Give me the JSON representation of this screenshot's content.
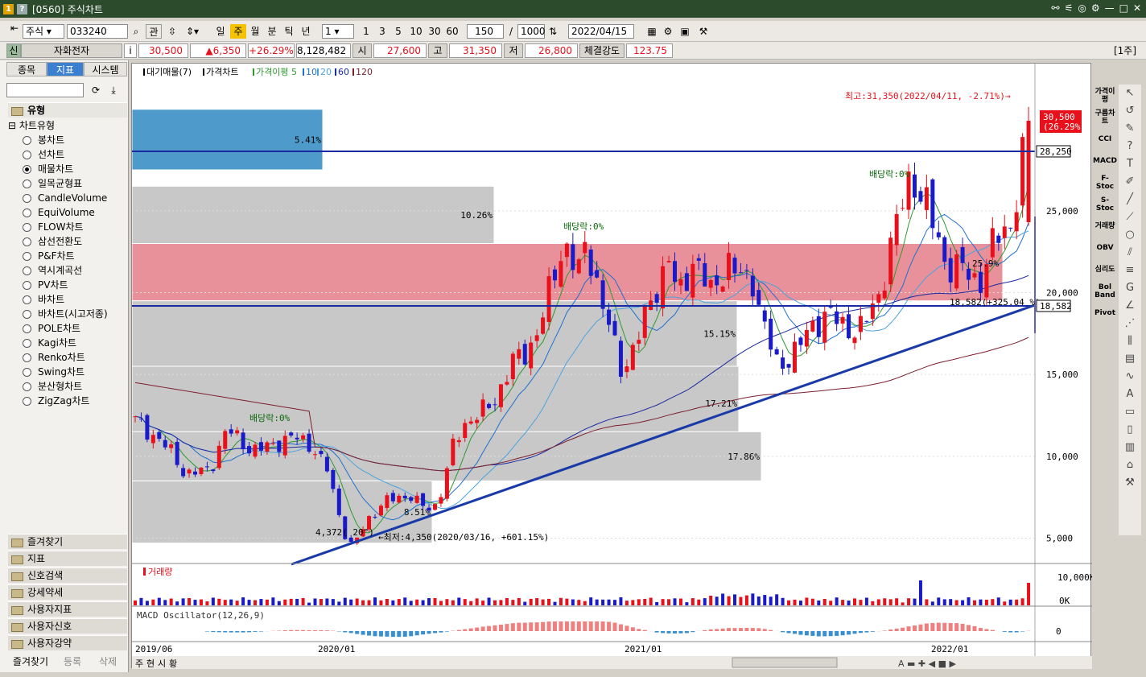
{
  "window": {
    "title": "[0560] 주식차트",
    "ico1": "1",
    "ico2": "?",
    "controls": [
      "⚯",
      "⚟",
      "◎",
      "⚙",
      "—",
      "□",
      "✕"
    ]
  },
  "toolbar": {
    "market": "주식",
    "code": "033240",
    "btn_gwan": "관",
    "periods": [
      "일",
      "주",
      "월",
      "분",
      "틱",
      "년"
    ],
    "unit": "1",
    "quick": [
      "1",
      "3",
      "5",
      "10",
      "30",
      "60"
    ],
    "count": "150",
    "total": "1000",
    "date": "2022/04/15"
  },
  "quote": {
    "badge": "신",
    "name": "자화전자",
    "info": "i",
    "price": "30,500",
    "change": "▲6,350",
    "rate": "+26.29%",
    "volume": "8,128,482",
    "open_label": "시",
    "open": "27,600",
    "high_label": "고",
    "high": "31,350",
    "low_label": "저",
    "low": "26,800",
    "power_label": "체결강도",
    "power": "123.75",
    "right_tag": "[1주]"
  },
  "left": {
    "tabs": [
      "종목",
      "지표",
      "시스템"
    ],
    "group": "유형",
    "tree": "차트유형",
    "items": [
      "봉차트",
      "선차트",
      "매물차트",
      "일목균형표",
      "CandleVolume",
      "EquiVolume",
      "FLOW차트",
      "삼선전환도",
      "P&F차트",
      "역시계곡선",
      "PV차트",
      "바차트",
      "바차트(시고저종)",
      "POLE차트",
      "Kagi차트",
      "Renko차트",
      "Swing차트",
      "분산형차트",
      "ZigZag차트"
    ],
    "selected": 2,
    "folders": [
      "즐겨찾기",
      "지표",
      "신호검색",
      "강세약세",
      "사용자지표",
      "사용자신호",
      "사용자강약"
    ],
    "bottom": [
      "즐겨찾기",
      "등록",
      "삭제"
    ]
  },
  "legend": {
    "items": [
      "대기매물(7)",
      "가격차트",
      "가격이평 5",
      "10",
      "20",
      "60",
      "120"
    ],
    "colors": [
      "#000000",
      "#000000",
      "#2e9a2e",
      "#1e6fcf",
      "#4aa3df",
      "#1a2aa0",
      "#7b1f2e"
    ]
  },
  "annotations": {
    "high": "최고:31,350(2022/04/11, -2.71%)→",
    "low": "←최저:4,350(2020/03/16, +601.15%)",
    "div1": "배당락:0%",
    "div2": "배당락:0%",
    "div3": "배당락:0%",
    "low_pt": "4,372( 20°)",
    "trend": "18,582(+325.04 %)",
    "pct_in": "25.9%"
  },
  "price_axis": {
    "labels": [
      "25,000",
      "20,000",
      "15,000",
      "10,000",
      "5,000"
    ],
    "values": [
      25000,
      20000,
      15000,
      10000,
      5000
    ],
    "last": "30,500",
    "last_rate": "(26.29%)",
    "hline1": "28,250",
    "hline2": "18,582"
  },
  "volume_pane": {
    "title": "거래량",
    "labels": [
      "10,000K",
      "0K"
    ]
  },
  "macd_pane": {
    "title": "MACD Oscillator(12,26,9)",
    "zero": "0"
  },
  "x_axis": [
    "2019/06",
    "2020/01",
    "2021/01",
    "2022/01"
  ],
  "scroll_tabs": [
    "주",
    "현",
    "시",
    "황"
  ],
  "colors": {
    "up": "#e8101a",
    "down": "#1a1ac8",
    "profile_blue": "#4d9acb",
    "profile_red": "#e8919a",
    "profile_gray": "#c8c8c8"
  },
  "chart_data": {
    "type": "candlestick",
    "volume_profile": [
      {
        "low": 27500,
        "high": 31200,
        "pct": "5.41%"
      },
      {
        "low": 23000,
        "high": 26500,
        "pct": "10.26%"
      },
      {
        "low": 19500,
        "high": 23000,
        "pct": "25.9%"
      },
      {
        "low": 15500,
        "high": 19500,
        "pct": "15.15%"
      },
      {
        "low": 11000,
        "high": 15500,
        "pct": "17.21%"
      },
      {
        "low": 8500,
        "high": 11500,
        "pct": "17.86%"
      },
      {
        "low": 4700,
        "high": 8500,
        "pct": "8.51%"
      }
    ],
    "ylim": [
      3500,
      33500
    ]
  },
  "right_tools": [
    "가격이평",
    "구름차트",
    "CCI",
    "MACD",
    "F-Stoc",
    "S-Stoc",
    "거래량",
    "OBV",
    "심리도",
    "Bol Band",
    "Pivot"
  ]
}
